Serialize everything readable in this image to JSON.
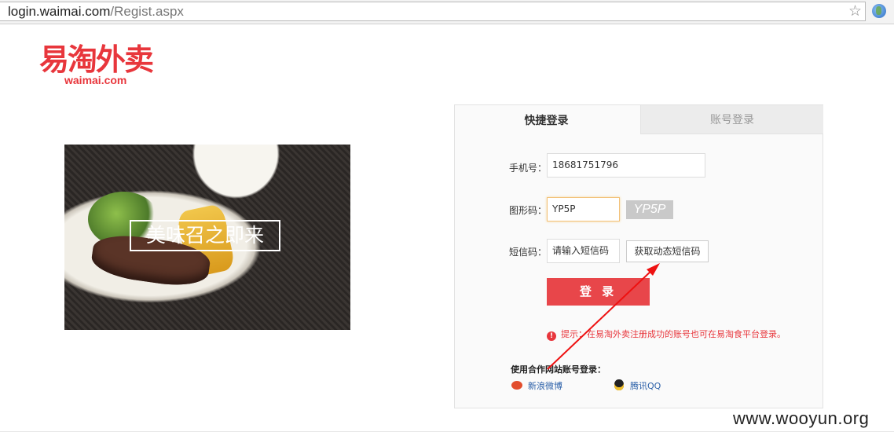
{
  "browser": {
    "url_host": "login.waimai.com",
    "url_path": "/Regist.aspx"
  },
  "logo": {
    "name_cn": "易淘外卖",
    "name_en": "waimai.com"
  },
  "banner": {
    "slogan": "美味召之即来"
  },
  "login_panel": {
    "tab_quick": "快捷登录",
    "tab_account": "账号登录",
    "phone_label": "手机号：",
    "phone_value": "18681751796",
    "captcha_label": "图形码：",
    "captcha_value": "YP5P",
    "captcha_image_text": "YP5P",
    "sms_label": "短信码：",
    "sms_placeholder": "请输入短信码",
    "sms_button": "获取动态短信码",
    "login_button": "登 录",
    "tip": "提示：在易淘外卖注册成功的账号也可在易淘食平台登录。",
    "partner_title": "使用合作网站账号登录：",
    "weibo": "新浪微博",
    "qq": "腾讯QQ"
  },
  "watermark": "www.wooyun.org",
  "colors": {
    "brand_red": "#e8363c",
    "button_red": "#e8464a",
    "link_blue": "#2a5fa8"
  }
}
